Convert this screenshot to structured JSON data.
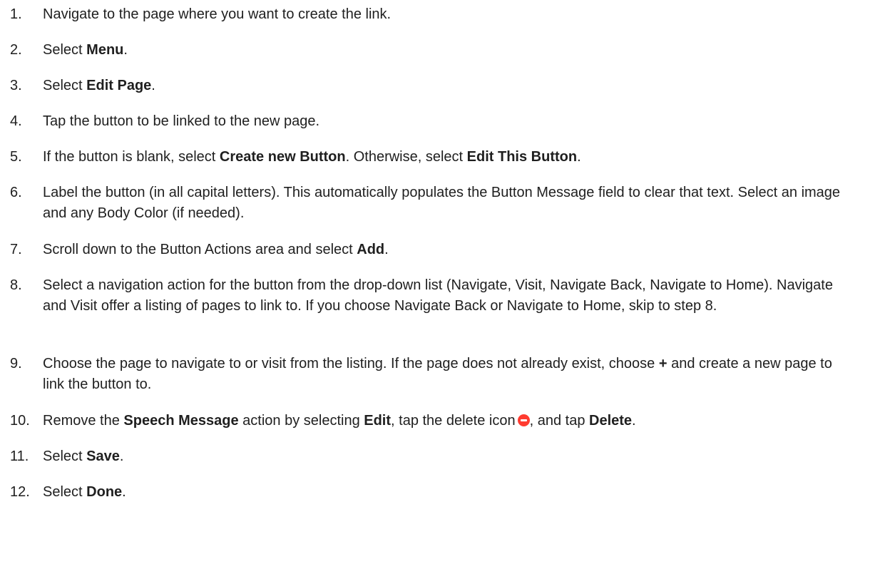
{
  "steps": [
    {
      "num": "1.",
      "segments": [
        {
          "t": "Navigate to the page where you want to create the link."
        }
      ]
    },
    {
      "num": "2.",
      "segments": [
        {
          "t": "Select "
        },
        {
          "t": "Menu",
          "b": true
        },
        {
          "t": "."
        }
      ]
    },
    {
      "num": "3.",
      "segments": [
        {
          "t": "Select "
        },
        {
          "t": "Edit Page",
          "b": true
        },
        {
          "t": "."
        }
      ]
    },
    {
      "num": "4.",
      "segments": [
        {
          "t": "Tap the button to be linked to the new page."
        }
      ]
    },
    {
      "num": "5.",
      "segments": [
        {
          "t": "If the button is blank, select "
        },
        {
          "t": "Create new Button",
          "b": true
        },
        {
          "t": ". Otherwise, select "
        },
        {
          "t": "Edit This Button",
          "b": true
        },
        {
          "t": "."
        }
      ]
    },
    {
      "num": "6.",
      "lines": 2,
      "segments": [
        {
          "t": "Label the button (in all capital letters). This automatically populates the Button Message field to clear that text. Select an image and any Body Color (if needed)."
        }
      ]
    },
    {
      "num": "7.",
      "segments": [
        {
          "t": "Scroll down to the Button Actions area and select "
        },
        {
          "t": "Add",
          "b": true
        },
        {
          "t": "."
        }
      ]
    },
    {
      "num": "8.",
      "lines": 3,
      "segments": [
        {
          "t": "Select a navigation action for the button from the drop-down list (Navigate, Visit, Navigate Back, Navigate to Home). Navigate and Visit offer a listing of pages to link to. If you choose Navigate Back or Navigate to Home, skip to step 8."
        }
      ]
    },
    {
      "num": "9.",
      "lines": 2,
      "segments": [
        {
          "t": "Choose the page to navigate to or visit from the listing. If the page does not already exist, choose "
        },
        {
          "t": "+",
          "b": true
        },
        {
          "t": " and create a new page to link the button to."
        }
      ]
    },
    {
      "num": "10.",
      "segments": [
        {
          "t": "Remove the "
        },
        {
          "t": "Speech Message",
          "b": true
        },
        {
          "t": " action by selecting "
        },
        {
          "t": "Edit",
          "b": true
        },
        {
          "t": ", tap the delete icon"
        },
        {
          "icon": "delete-icon"
        },
        {
          "t": ", and tap "
        },
        {
          "t": "Delete",
          "b": true
        },
        {
          "t": "."
        }
      ]
    },
    {
      "num": "11.",
      "segments": [
        {
          "t": "Select "
        },
        {
          "t": "Save",
          "b": true
        },
        {
          "t": "."
        }
      ]
    },
    {
      "num": "12.",
      "segments": [
        {
          "t": "Select "
        },
        {
          "t": "Done",
          "b": true
        },
        {
          "t": "."
        }
      ]
    }
  ],
  "colors": {
    "text": "#1f1f1f",
    "delete_icon": "#ff3b30"
  }
}
